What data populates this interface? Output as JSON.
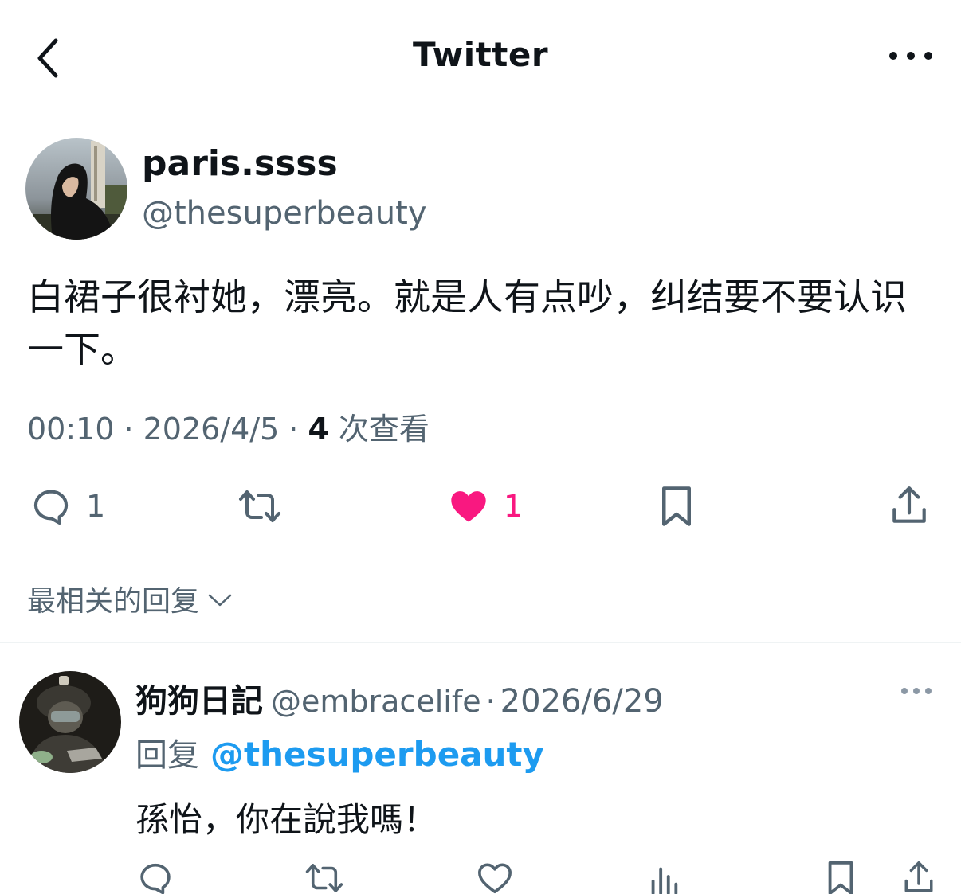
{
  "header": {
    "title": "Twitter",
    "back_icon": "chevron-left-icon",
    "more_icon": "ellipsis-icon"
  },
  "tweet": {
    "display_name": "paris.ssss",
    "handle": "@thesuperbeauty",
    "text": "白裙子很衬她，漂亮。就是人有点吵，纠结要不要认识一下。",
    "time": "00:10",
    "date": "2026/4/5",
    "views_count": "4",
    "views_label": "次查看",
    "separator": "·",
    "actions": {
      "reply_count": "1",
      "retweet_count": "",
      "like_count": "1",
      "like_color": "#f91880"
    }
  },
  "replies_sort": {
    "label": "最相关的回复"
  },
  "reply": {
    "display_name": "狗狗日記",
    "handle": "@embracelife",
    "separator": "·",
    "date": "2026/6/29",
    "reply_to_label": "回复",
    "reply_to_handle": "@thesuperbeauty",
    "text": "孫怡，你在說我嗎！",
    "link_color": "#1d9bf0"
  },
  "colors": {
    "text_primary": "#0f1419",
    "text_secondary": "#536471",
    "divider": "#eff3f4"
  }
}
